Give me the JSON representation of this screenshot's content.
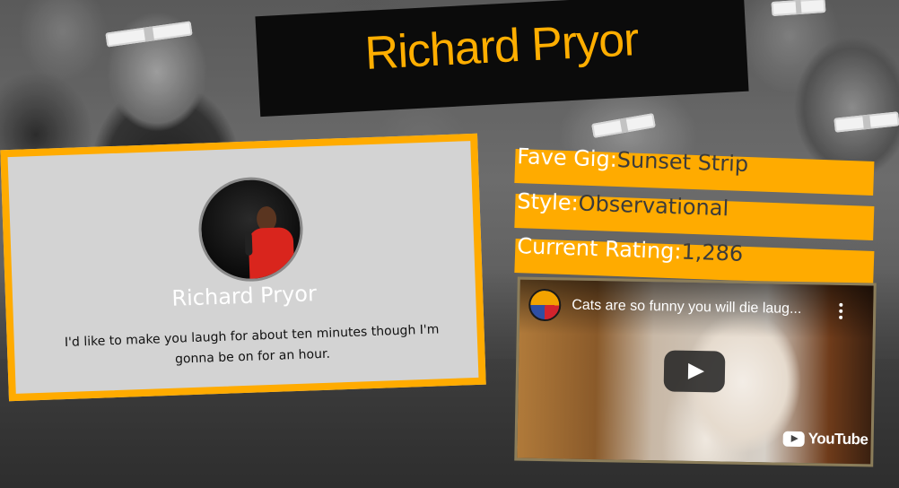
{
  "header": {
    "title": "Richard Pryor"
  },
  "profile": {
    "name": "Richard Pryor",
    "quote": "I'd like to make you laugh for about ten minutes though I'm gonna be on for an hour."
  },
  "stats": [
    {
      "label": "Fave Gig:",
      "value": "Sunset Strip"
    },
    {
      "label": "Style:",
      "value": "Observational"
    },
    {
      "label": "Current Rating:",
      "value": "1,286"
    }
  ],
  "video": {
    "title": "Cats are so funny you will die laug...",
    "brand": "YouTube"
  },
  "colors": {
    "accent": "#ffab00",
    "title_bg": "#0b0b0b",
    "card_bg": "#d3d3d3"
  }
}
